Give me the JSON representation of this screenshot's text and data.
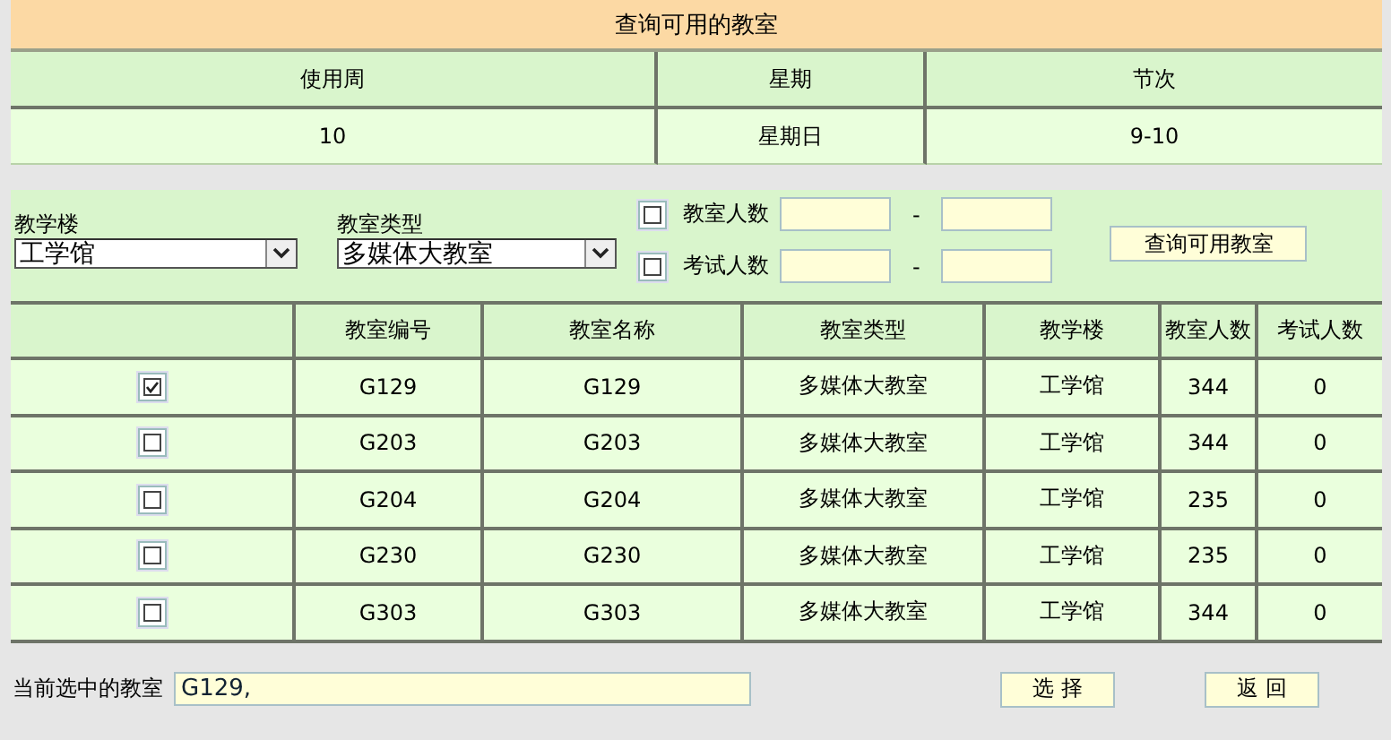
{
  "title": "查询可用的教室",
  "info": {
    "columns": [
      "使用周",
      "星期",
      "节次"
    ],
    "values": [
      "10",
      "星期日",
      "9-10"
    ]
  },
  "filters": {
    "building": {
      "label": "教学楼",
      "value": "工学馆"
    },
    "room_type": {
      "label": "教室类型",
      "value": "多媒体大教室"
    },
    "ranges": [
      {
        "label": "教室人数",
        "checked": false
      },
      {
        "label": "考试人数",
        "checked": false
      }
    ],
    "range_separator": "-",
    "query_button": "查询可用教室"
  },
  "table": {
    "columns": [
      "教室编号",
      "教室名称",
      "教室类型",
      "教学楼",
      "教室人数",
      "考试人数"
    ],
    "rows": [
      {
        "selected": true,
        "cells": [
          "G129",
          "G129",
          "多媒体大教室",
          "工学馆",
          "344",
          "0"
        ]
      },
      {
        "selected": false,
        "cells": [
          "G203",
          "G203",
          "多媒体大教室",
          "工学馆",
          "344",
          "0"
        ]
      },
      {
        "selected": false,
        "cells": [
          "G204",
          "G204",
          "多媒体大教室",
          "工学馆",
          "235",
          "0"
        ]
      },
      {
        "selected": false,
        "cells": [
          "G230",
          "G230",
          "多媒体大教室",
          "工学馆",
          "235",
          "0"
        ]
      },
      {
        "selected": false,
        "cells": [
          "G303",
          "G303",
          "多媒体大教室",
          "工学馆",
          "344",
          "0"
        ]
      }
    ]
  },
  "selection": {
    "label": "当前选中的教室",
    "value": "G129,"
  },
  "buttons": [
    "选 择",
    "返 回"
  ]
}
